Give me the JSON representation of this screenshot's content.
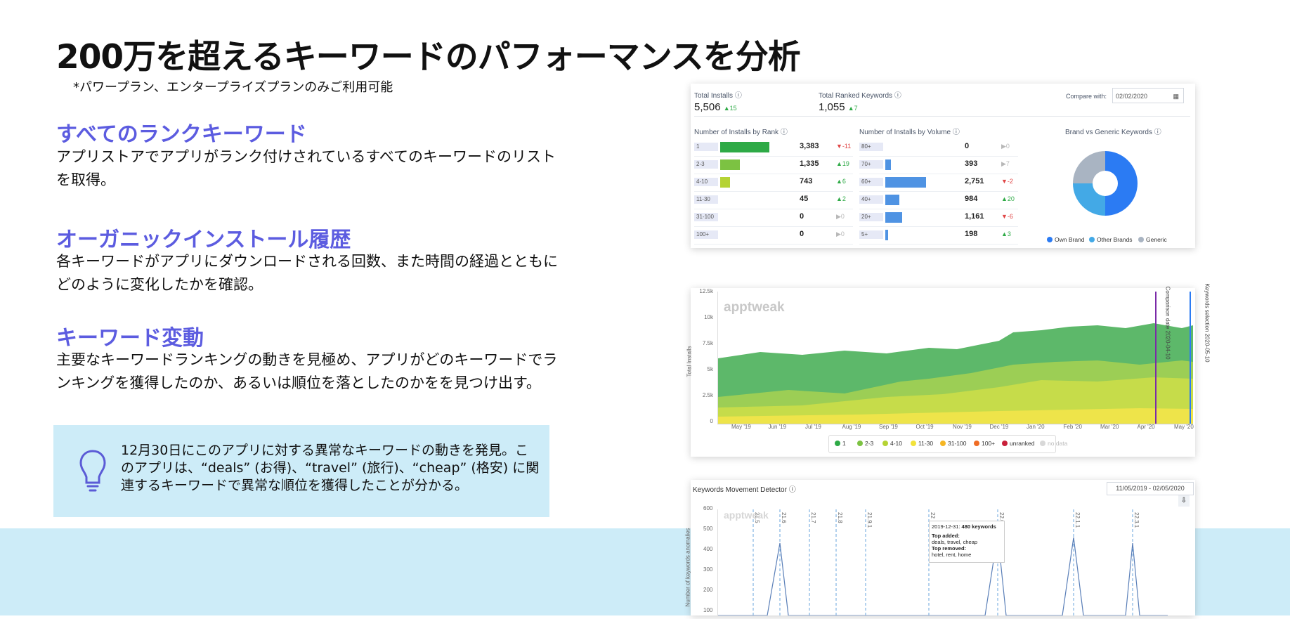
{
  "title": "200万を超えるキーワードのパフォーマンスを分析",
  "subnote": "*パワープラン、エンタープライズプランのみご利用可能",
  "features": [
    {
      "heading": "すべてのランクキーワード",
      "body": "アプリストアでアプリがランク付けされているすべてのキーワードのリストを取得。"
    },
    {
      "heading": "オーガニックインストール履歴",
      "body": "各キーワードがアプリにダウンロードされる回数、また時間の経過とともにどのように変化したかを確認。"
    },
    {
      "heading": "キーワード変動",
      "body": "主要なキーワードランキングの動きを見極め、アプリがどのキーワードでランキングを獲得したのか、あるいは順位を落としたのかをを見つけ出す。"
    }
  ],
  "tip": {
    "icon": "lightbulb-icon",
    "text": "12月30日にこのアプリに対する異常なキーワードの動きを発見。このアプリは、“deals” (お得)、“travel” (旅行)、“cheap” (格安) に関連するキーワードで異常な順位を獲得したことが分かる。"
  },
  "dashboard": {
    "total_installs_label": "Total Installs",
    "total_installs_value": "5,506",
    "total_installs_change": "▲15",
    "total_ranked_label": "Total Ranked Keywords",
    "total_ranked_value": "1,055",
    "total_ranked_change": "▲7",
    "compare_label": "Compare with:",
    "compare_date": "02/02/2020",
    "by_rank_title": "Number of Installs by Rank",
    "by_rank_rows": [
      {
        "label": "1",
        "value": "3,383",
        "change": "▼-11",
        "dir": "dn",
        "fill": 0.88
      },
      {
        "label": "2-3",
        "value": "1,335",
        "change": "▲19",
        "dir": "up",
        "fill": 0.35
      },
      {
        "label": "4-10",
        "value": "743",
        "change": "▲6",
        "dir": "up",
        "fill": 0.18
      },
      {
        "label": "11-30",
        "value": "45",
        "change": "▲2",
        "dir": "up",
        "fill": 0
      },
      {
        "label": "31-100",
        "value": "0",
        "change": "▶0",
        "dir": "gray",
        "fill": 0
      },
      {
        "label": "100+",
        "value": "0",
        "change": "▶0",
        "dir": "gray",
        "fill": 0
      }
    ],
    "by_volume_title": "Number of Installs by Volume",
    "by_volume_rows": [
      {
        "label": "80+",
        "value": "0",
        "change": "▶0",
        "dir": "gray",
        "fill": 0
      },
      {
        "label": "70+",
        "value": "393",
        "change": "▶7",
        "dir": "gray",
        "fill": 0.1
      },
      {
        "label": "60+",
        "value": "2,751",
        "change": "▼-2",
        "dir": "dn",
        "fill": 0.72
      },
      {
        "label": "40+",
        "value": "984",
        "change": "▲20",
        "dir": "up",
        "fill": 0.25
      },
      {
        "label": "20+",
        "value": "1,161",
        "change": "▼-6",
        "dir": "dn",
        "fill": 0.3
      },
      {
        "label": "5+",
        "value": "198",
        "change": "▲3",
        "dir": "up",
        "fill": 0.05
      }
    ],
    "donut_title": "Brand vs Generic Keywords",
    "donut": [
      {
        "name": "Own Brand",
        "value": 0.5,
        "color": "#2b7bf3"
      },
      {
        "name": "Other Brands",
        "value": 0.25,
        "color": "#43a9e6"
      },
      {
        "name": "Generic",
        "value": 0.25,
        "color": "#a9b4c2"
      }
    ]
  },
  "installs_chart": {
    "watermark": "apptweak",
    "ylabel": "Total Installs",
    "yticks": [
      "12.5k",
      "10k",
      "7.5k",
      "5k",
      "2.5k",
      "0"
    ],
    "xticks": [
      "May '19",
      "Jun '19",
      "Jul '19",
      "Aug '19",
      "Sep '19",
      "Oct '19",
      "Nov '19",
      "Dec '19",
      "Jan '20",
      "Feb '20",
      "Mar '20",
      "Apr '20",
      "May '20"
    ],
    "marker1": "Comparison date 2020-04-10",
    "marker2": "Keywords selection 2020-05-10",
    "legend": [
      {
        "name": "1",
        "color": "#2eaa46"
      },
      {
        "name": "2-3",
        "color": "#7cc242"
      },
      {
        "name": "4-10",
        "color": "#b5d334"
      },
      {
        "name": "11-30",
        "color": "#f2e23a"
      },
      {
        "name": "31-100",
        "color": "#f5b624"
      },
      {
        "name": "100+",
        "color": "#ef6c24"
      },
      {
        "name": "unranked",
        "color": "#c8203a"
      },
      {
        "name": "no data",
        "color": "#d8d8d8"
      }
    ]
  },
  "movement": {
    "title": "Keywords Movement Detector",
    "date_range": "11/05/2019 - 02/05/2020",
    "ylabel": "Number of keywords anomalies",
    "yticks": [
      "600",
      "500",
      "400",
      "300",
      "200",
      "100"
    ],
    "versions": [
      "21.5",
      "21.6",
      "21.7",
      "21.8",
      "21.9.1",
      "22",
      "22.0.0",
      "22.1.1",
      "22.3.1"
    ],
    "tooltip_date": "2019-12-31:",
    "tooltip_count": "480 keywords",
    "tooltip_added_label": "Top added:",
    "tooltip_added": "deals, travel, cheap",
    "tooltip_removed_label": "Top removed:",
    "tooltip_removed": "hotel, rent, home"
  }
}
